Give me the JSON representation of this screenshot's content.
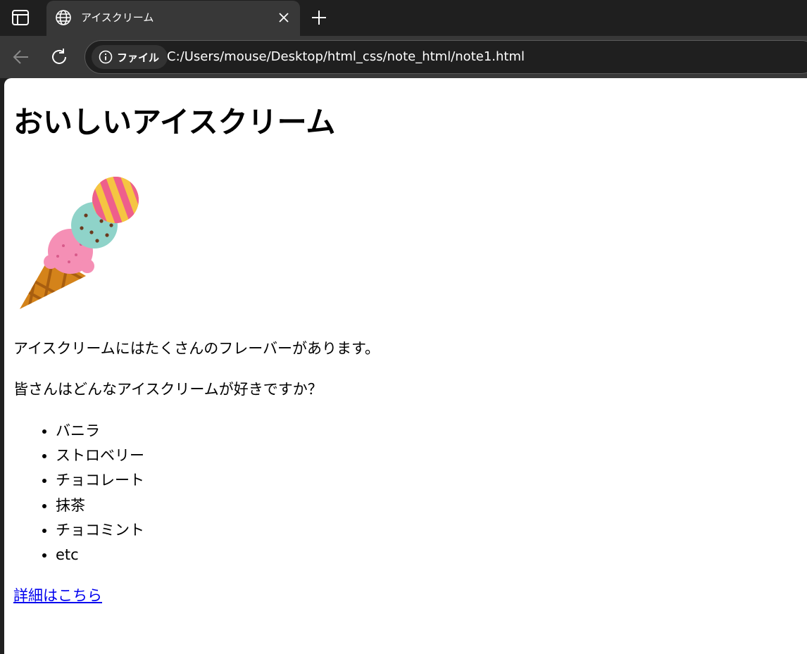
{
  "browser": {
    "tab": {
      "title": "アイスクリーム"
    },
    "address_bar": {
      "site_info_label": "ファイル",
      "url": "C:/Users/mouse/Desktop/html_css/note_html/note1.html"
    },
    "icons": {
      "sidebar_toggle": "sidebar-toggle-icon",
      "tab_site": "globe-icon",
      "tab_close": "close-icon",
      "new_tab": "plus-icon",
      "back": "back-arrow-icon",
      "reload": "reload-icon",
      "site_info": "info-icon"
    },
    "colors": {
      "tabstrip": "#1f1f1f",
      "toolbar": "#383838",
      "address_bar": "#1f1f1f"
    }
  },
  "page": {
    "title": "おいしいアイスクリーム",
    "paragraphs": [
      "アイスクリームにはたくさんのフレーバーがあります。",
      "皆さんはどんなアイスクリームが好きですか？"
    ],
    "flavors": [
      "バニラ",
      "ストロベリー",
      "チョコレート",
      "抹茶",
      "チョコミント",
      "etc"
    ],
    "link_text": "詳細はこちら",
    "colors": {
      "link": "#0000ee",
      "background": "#ffffff",
      "text": "#000000"
    }
  }
}
